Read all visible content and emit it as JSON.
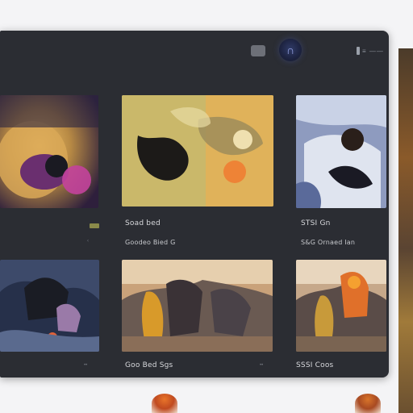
{
  "colors": {
    "background": "#f4f4f6",
    "panel": "#2b2d33",
    "caption": "#d8d9dd",
    "accent": "#9aa6e8"
  },
  "toolbar": {
    "view_toggle_icon": "square-icon",
    "profile_icon": "headphones-icon",
    "menu_label": "≡ ——"
  },
  "gallery": {
    "items": [
      {
        "title": "",
        "subtitle": "",
        "icon": "llama-art"
      },
      {
        "title": "Soad bed",
        "subtitle": "Goodeo Bied G",
        "icon": "ink-art"
      },
      {
        "title": "STSI Gn",
        "subtitle": "S&G Ornaed Ian",
        "icon": "snow-art"
      },
      {
        "title": "",
        "subtitle": "",
        "icon": "ruins-blue"
      },
      {
        "title": "Goo Bed Sgs",
        "subtitle": "",
        "icon": "ruins-warm"
      },
      {
        "title": "SSSI Coos",
        "subtitle": "",
        "icon": "ruins-fire"
      }
    ]
  }
}
